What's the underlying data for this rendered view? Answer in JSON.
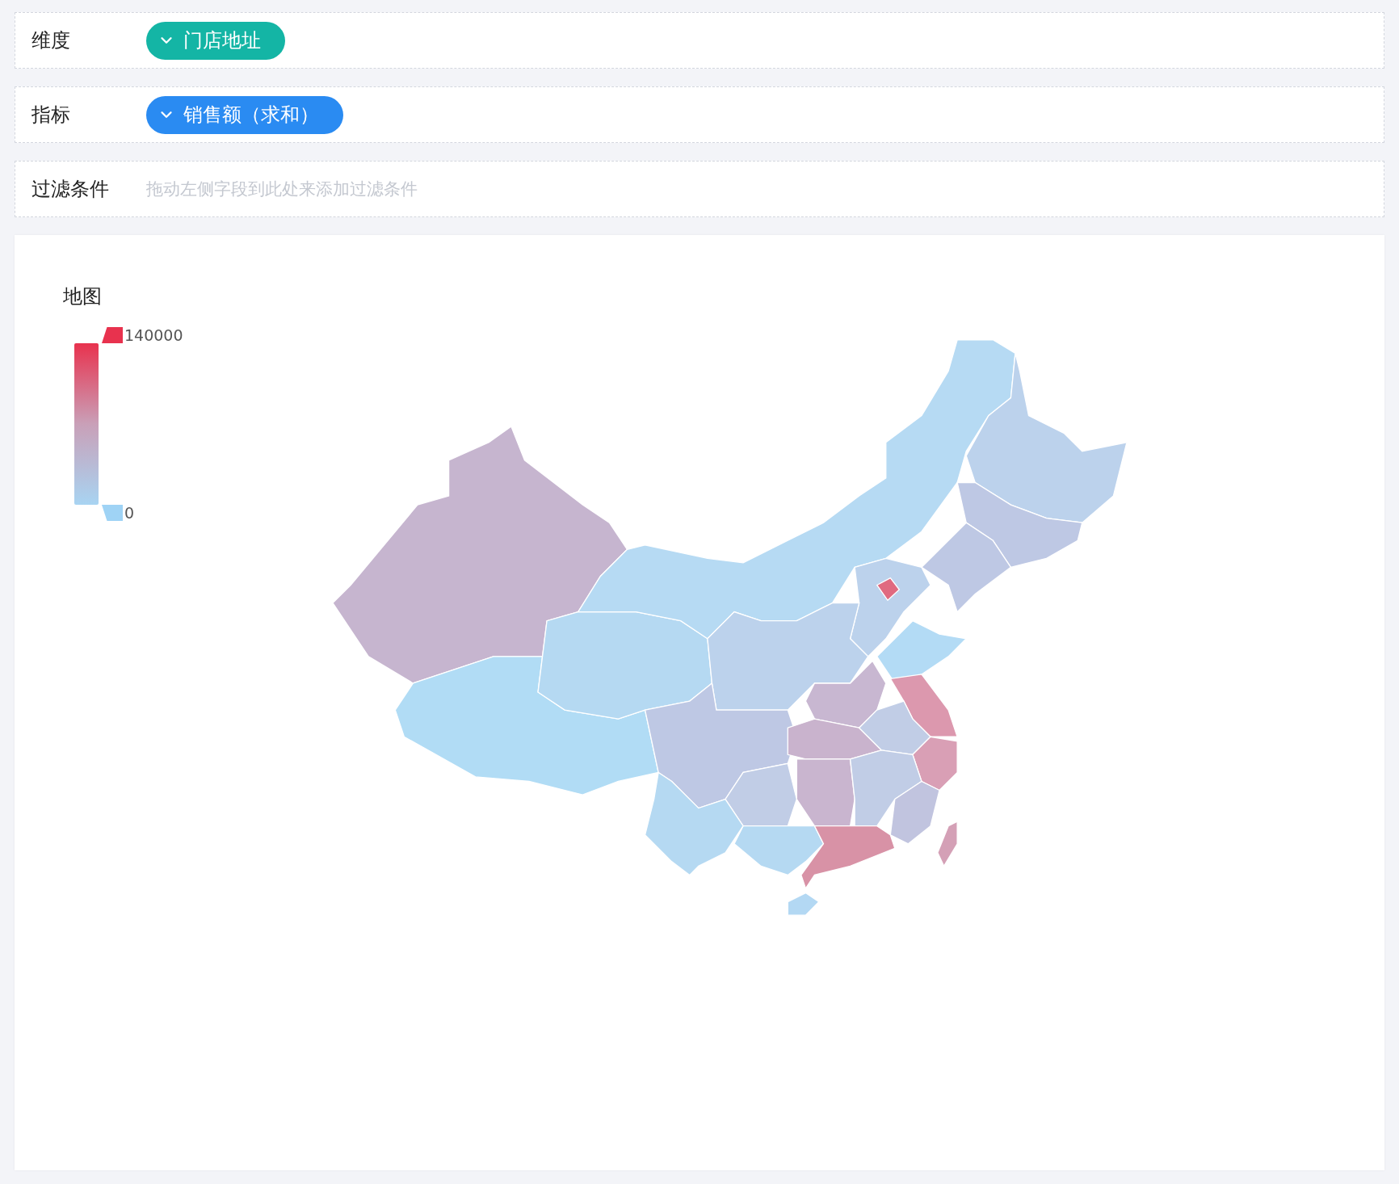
{
  "fields": [
    {
      "kind": "pill",
      "label": "维度",
      "value": "门店地址",
      "color": "#14b5a5"
    },
    {
      "kind": "pill",
      "label": "指标",
      "value": "销售额（求和）",
      "color": "#2a8bf2"
    },
    {
      "kind": "drop",
      "label": "过滤条件",
      "placeholder": "拖动左侧字段到此处来添加过滤条件"
    }
  ],
  "chart": {
    "title": "地图",
    "legend": {
      "max": "140000",
      "min": "0"
    }
  }
}
